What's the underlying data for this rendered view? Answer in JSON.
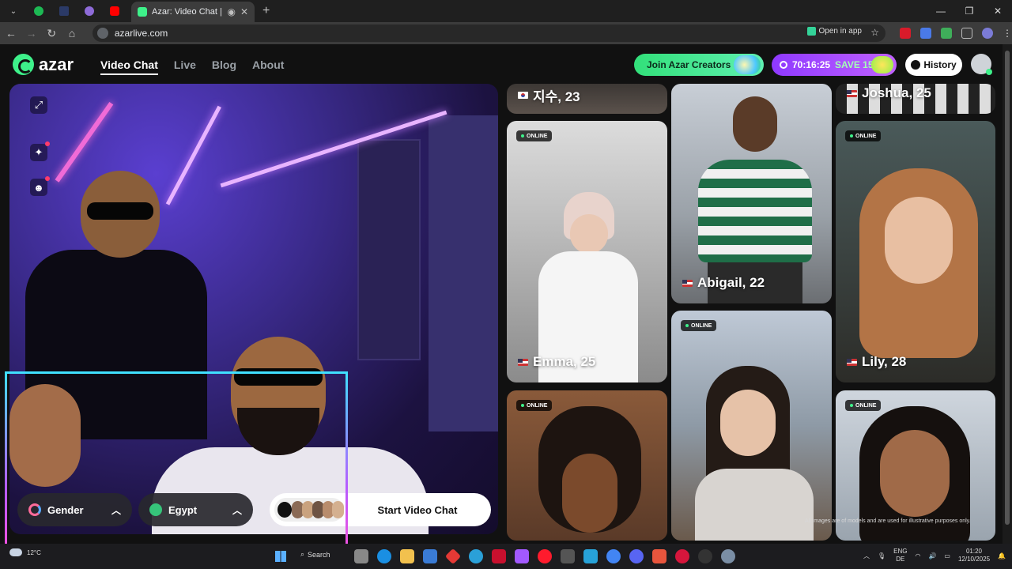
{
  "browser": {
    "pinned_tabs": [
      {
        "icon": "spotify-icon",
        "color": "#1db954"
      },
      {
        "icon": "mx-icon",
        "color": "#2b3a67"
      },
      {
        "icon": "globe-icon",
        "color": "#8e6bd8"
      },
      {
        "icon": "youtube-icon",
        "color": "#ff0000"
      }
    ],
    "active_tab_title": "Azar: Video Chat | Alternati",
    "new_tab_symbol": "+",
    "url": "azarlive.com",
    "open_in_app": "Open in app"
  },
  "site": {
    "logo_text": "azar",
    "nav": [
      {
        "label": "Video Chat",
        "active": true
      },
      {
        "label": "Live",
        "active": false
      },
      {
        "label": "Blog",
        "active": false
      },
      {
        "label": "About",
        "active": false
      }
    ],
    "creators_label": "Join Azar Creators",
    "promo_timer": "70:16:25",
    "promo_save": "SAVE 15%",
    "history_label": "History"
  },
  "video": {
    "gender_label": "Gender",
    "country_label": "Egypt",
    "start_label": "Start Video Chat"
  },
  "cards": [
    {
      "name": "지수, 23",
      "flag": "kr",
      "online": false
    },
    {
      "name": "Joshua, 25",
      "flag": "us",
      "online": false
    },
    {
      "name": "Emma, 25",
      "flag": "us",
      "online": true
    },
    {
      "name": "Abigail, 22",
      "flag": "us",
      "online": false
    },
    {
      "name": "Lily, 28",
      "flag": "us",
      "online": true
    },
    {
      "name": "",
      "flag": "",
      "online": true
    },
    {
      "name": "",
      "flag": "",
      "online": true
    },
    {
      "name": "",
      "flag": "",
      "online": true
    }
  ],
  "online_label": "ONLINE",
  "disclaimer": "All images are of models and are used for illustrative purposes only.",
  "taskbar": {
    "temperature": "12°C",
    "search_label": "Search",
    "lang_line1": "ENG",
    "lang_line2": "DE",
    "time": "01:20",
    "date": "12/10/2025"
  }
}
